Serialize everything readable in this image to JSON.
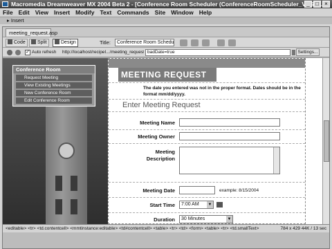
{
  "window": {
    "title": "Macromedia Dreamweaver MX 2004 Beta 2 - [Conference Room Scheduler (ConferenceRoomScheduler_VBS/m..."
  },
  "menu": [
    "File",
    "Edit",
    "View",
    "Insert",
    "Modify",
    "Text",
    "Commands",
    "Site",
    "Window",
    "Help"
  ],
  "insert_bar": {
    "label": "Insert"
  },
  "document": {
    "tab": "meeting_request.asp",
    "toolbar": {
      "code": "Code",
      "split": "Split",
      "design": "Design",
      "title_label": "Title:",
      "title_value": "Conference Room Scheduler"
    },
    "address": {
      "autorefresh": "Auto refresh",
      "url": "http://localhost/recipeI.../meeting_request.asp",
      "params": "badDate=true",
      "settings": "Settings..."
    }
  },
  "nav": {
    "heading": "Conference Room",
    "items": [
      "Request Meeting",
      "View Existing Meetings",
      "New Conference Room",
      "Edit Conference Room"
    ]
  },
  "form": {
    "heading": "MEETING REQUEST",
    "error": "The date you entered was not in the proper format. Dates should be in the format mm/dd/yyyy.",
    "subheading": "Enter Meeting Request",
    "labels": {
      "meeting_name": "Meeting Name",
      "meeting_owner": "Meeting Owner",
      "meeting_description_1": "Meeting",
      "meeting_description_2": "Description",
      "meeting_date": "Meeting Date",
      "start_time": "Start Time",
      "duration": "Duration"
    },
    "date_example": "example: 8/15/2004",
    "start_time_value": "7:00 AM",
    "duration_value": "30 Minutes"
  },
  "status": {
    "tags": "<editable> <tr> <td.contentcell> <mmtinstance:editable> <td#contentcell> <table> <tr> <td> <form> <table> <tr> <td.smallText>",
    "info": "784 x 429  44K / 13 sec"
  }
}
